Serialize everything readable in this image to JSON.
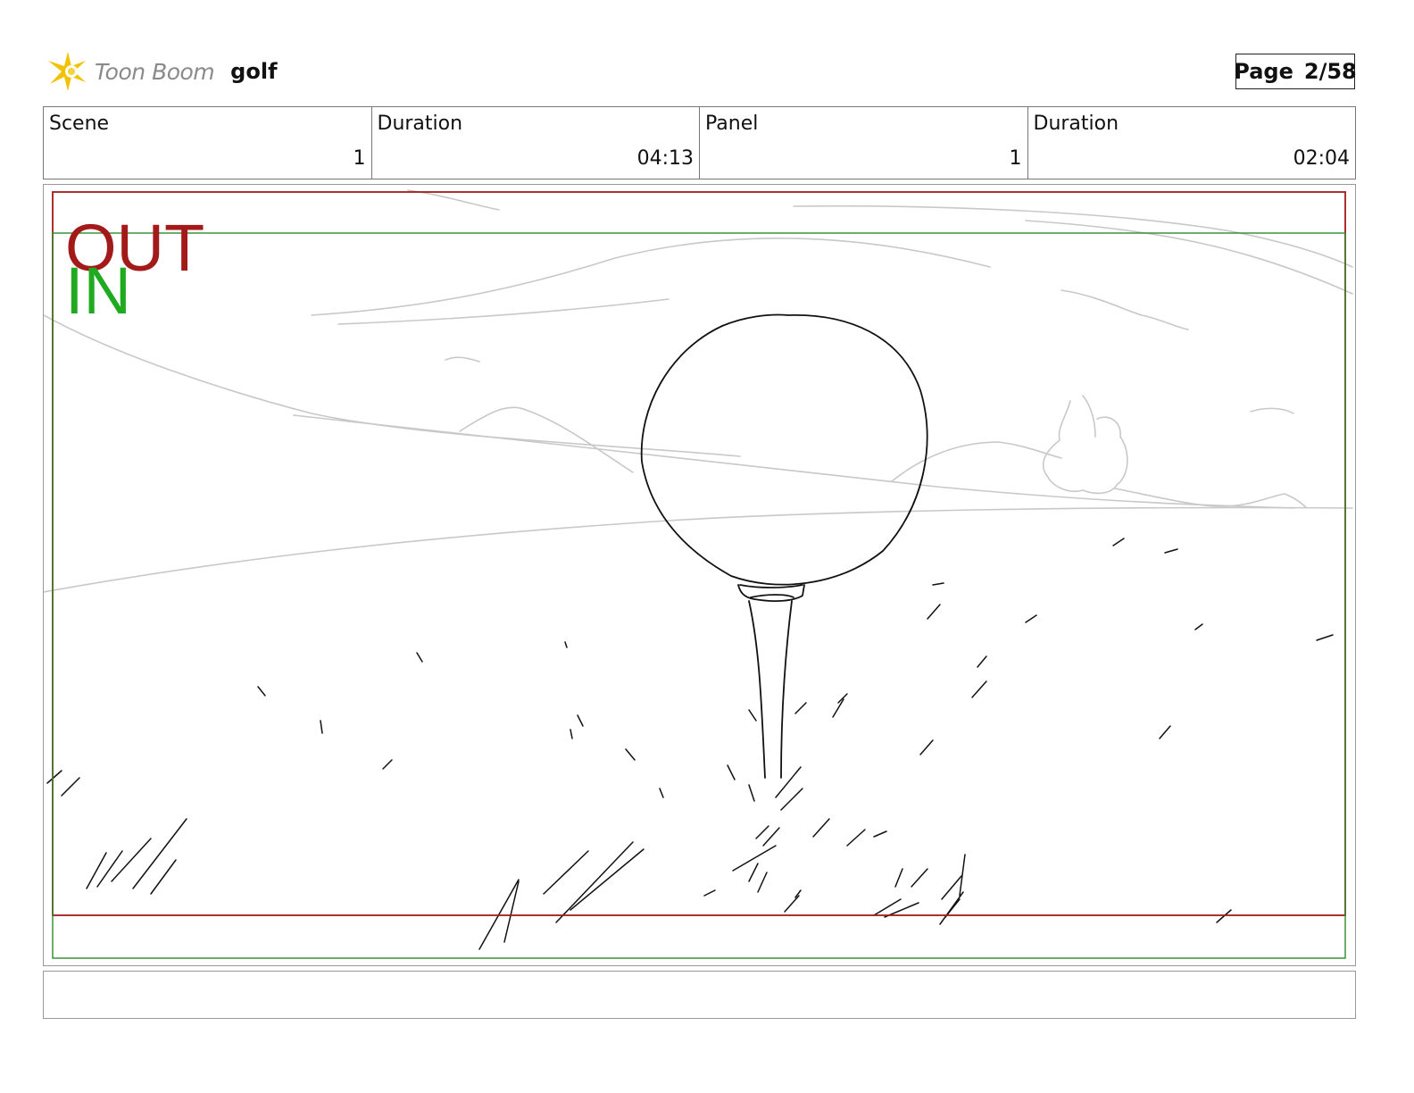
{
  "header": {
    "brand": "Toon Boom",
    "project": "golf",
    "page_label": "Page",
    "page_value": "2/58"
  },
  "info": {
    "scene_label": "Scene",
    "scene_value": "1",
    "scene_duration_label": "Duration",
    "scene_duration_value": "04:13",
    "panel_label": "Panel",
    "panel_value": "1",
    "panel_duration_label": "Duration",
    "panel_duration_value": "02:04"
  },
  "frame": {
    "out_label": "OUT",
    "in_label": "IN",
    "out_color": "#a31a1a",
    "in_color": "#1faa1f"
  },
  "colors": {
    "logo_star": "#f2c200",
    "brand_gray": "#8a8a8a",
    "sketch_light": "#c8c8c8",
    "sketch_dark": "#111111"
  }
}
